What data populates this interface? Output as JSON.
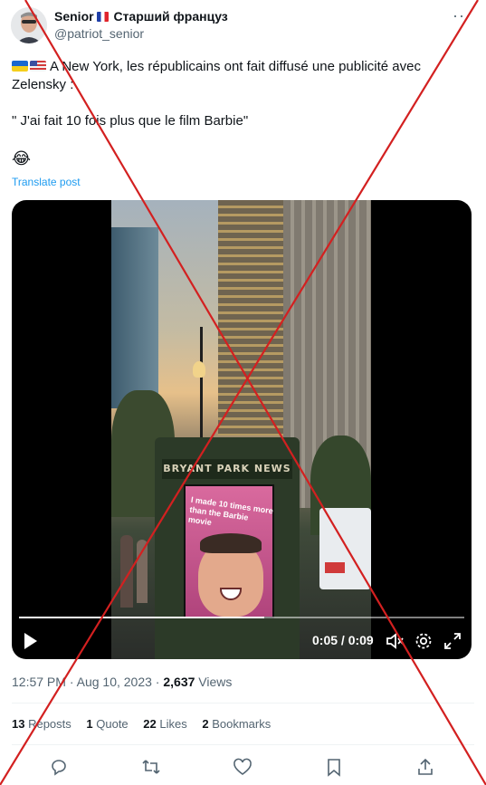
{
  "author": {
    "display_name": "Senior",
    "display_name_suffix": "Старший француз",
    "handle": "@patriot_senior"
  },
  "tweet": {
    "line1": "A New York, les républicains ont fait diffusé une publicité avec",
    "line2": "Zelensky :",
    "quote": " \" J'ai fait 10 fois plus que le film Barbie\"",
    "emoji": "😂",
    "translate_label": "Translate post"
  },
  "video": {
    "kiosk_sign": "BRYANT PARK NEWS",
    "screen_text": "I made 10 times more than the Barbie movie",
    "time_display": "0:05 / 0:09",
    "progress_fraction": 0.55
  },
  "meta": {
    "time": "12:57 PM",
    "separator": " · ",
    "date": "Aug 10, 2023",
    "views_count": "2,637",
    "views_label": " Views"
  },
  "stats": {
    "reposts_count": "13",
    "reposts_label": " Reposts",
    "quotes_count": "1",
    "quotes_label": " Quote",
    "likes_count": "22",
    "likes_label": " Likes",
    "bookmarks_count": "2",
    "bookmarks_label": " Bookmarks"
  },
  "colors": {
    "link": "#1d9bf0",
    "secondary_text": "#536471",
    "overlay_cross": "#d32020"
  },
  "icons": [
    "more-icon",
    "play-icon",
    "mute-icon",
    "settings-icon",
    "fullscreen-icon",
    "reply-icon",
    "repost-icon",
    "like-icon",
    "bookmark-icon",
    "share-icon"
  ]
}
